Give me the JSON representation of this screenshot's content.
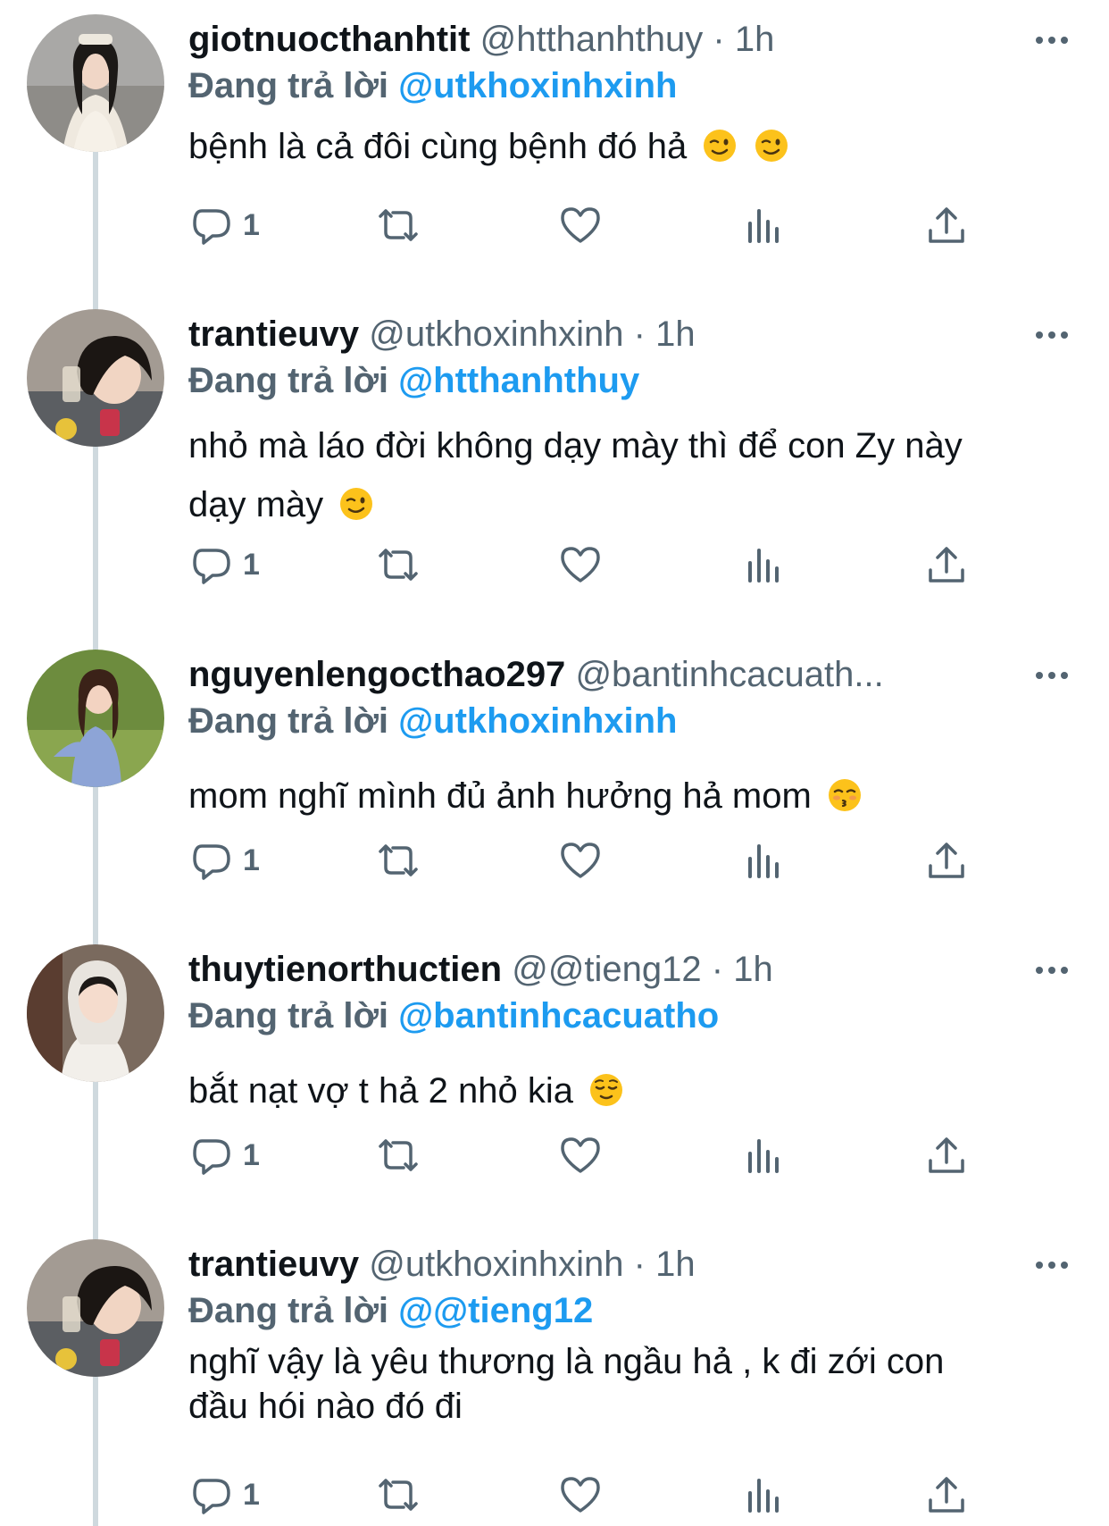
{
  "tweets": [
    {
      "name": "giotnuocthanhtit",
      "handle": "@htthanhthuy",
      "time": "1h",
      "replying_label": "Đang trả lời",
      "replying_to": "@utkhoxinhxinh",
      "text": "bệnh là cả đôi cùng bệnh đó hả",
      "emoji": [
        "wink-emoji",
        "wink-emoji"
      ],
      "reply_count": "1"
    },
    {
      "name": "trantieuvy",
      "handle": "@utkhoxinhxinh",
      "time": "1h",
      "replying_label": "Đang trả lời",
      "replying_to": "@htthanhthuy",
      "text": "nhỏ mà láo đời không dạy mày thì để con Zy này",
      "text_line2": "dạy mày",
      "emoji": [
        "wink-emoji"
      ],
      "reply_count": "1"
    },
    {
      "name": "nguyenlengocthao297",
      "handle": "@bantinhcacuath...",
      "time": "",
      "replying_label": "Đang trả lời",
      "replying_to": "@utkhoxinhxinh",
      "text": "mom nghĩ mình đủ ảnh hưởng hả mom",
      "emoji": [
        "kissing-emoji"
      ],
      "reply_count": "1"
    },
    {
      "name": "thuytienorthuctien",
      "handle": "@@tieng12",
      "time": "1h",
      "replying_label": "Đang trả lời",
      "replying_to": "@bantinhcacuatho",
      "text": "bắt nạt vợ t hả 2 nhỏ kia",
      "emoji": [
        "relieved-emoji"
      ],
      "reply_count": "1"
    },
    {
      "name": "trantieuvy",
      "handle": "@utkhoxinhxinh",
      "time": "1h",
      "replying_label": "Đang trả lời",
      "replying_to": "@@tieng12",
      "text": "nghĩ vậy là yêu thương là ngầu hả , k đi zới con",
      "text_line2": "đầu hói nào đó đi",
      "emoji": [],
      "reply_count": "1"
    }
  ],
  "separator": "·",
  "colors": {
    "link": "#1d9bf0",
    "secondary": "#536471",
    "primary_text": "#0f1419",
    "thread_line": "#cfd9de"
  },
  "icons": [
    "reply-icon",
    "retweet-icon",
    "like-icon",
    "views-icon",
    "share-icon",
    "more-icon"
  ]
}
